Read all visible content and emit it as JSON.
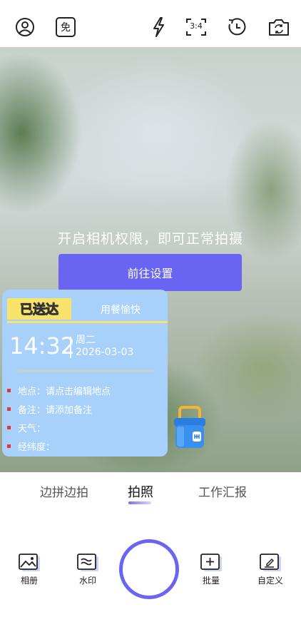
{
  "topbar": {
    "icons": [
      "user-icon",
      "free-badge-icon",
      "flash-icon",
      "aspect-ratio-icon",
      "timer-icon",
      "switch-camera-icon"
    ],
    "free_badge": "免",
    "aspect_ratio": "3:4"
  },
  "preview": {
    "permission_message": "开启相机权限，即可正常拍摄",
    "permission_button": "前往设置"
  },
  "watermark": {
    "tag": "已送达",
    "subtitle": "用餐愉快",
    "time": "14:32",
    "weekday": "周二",
    "date": "2026-03-03",
    "lines": [
      "地点：请点击编辑地点",
      "备注：请添加备注",
      "天气：",
      "经纬度："
    ],
    "colors": {
      "card": "#a7d1fb",
      "tag": "#f7e36a",
      "bullet": "#e5343a"
    }
  },
  "modes": {
    "items": [
      "边拼边拍",
      "拍照",
      "工作汇报"
    ],
    "active": "拍照"
  },
  "toolbar": {
    "album": "相册",
    "watermark": "水印",
    "batch": "批量",
    "custom": "自定义"
  },
  "accent_color": "#6a64f3"
}
